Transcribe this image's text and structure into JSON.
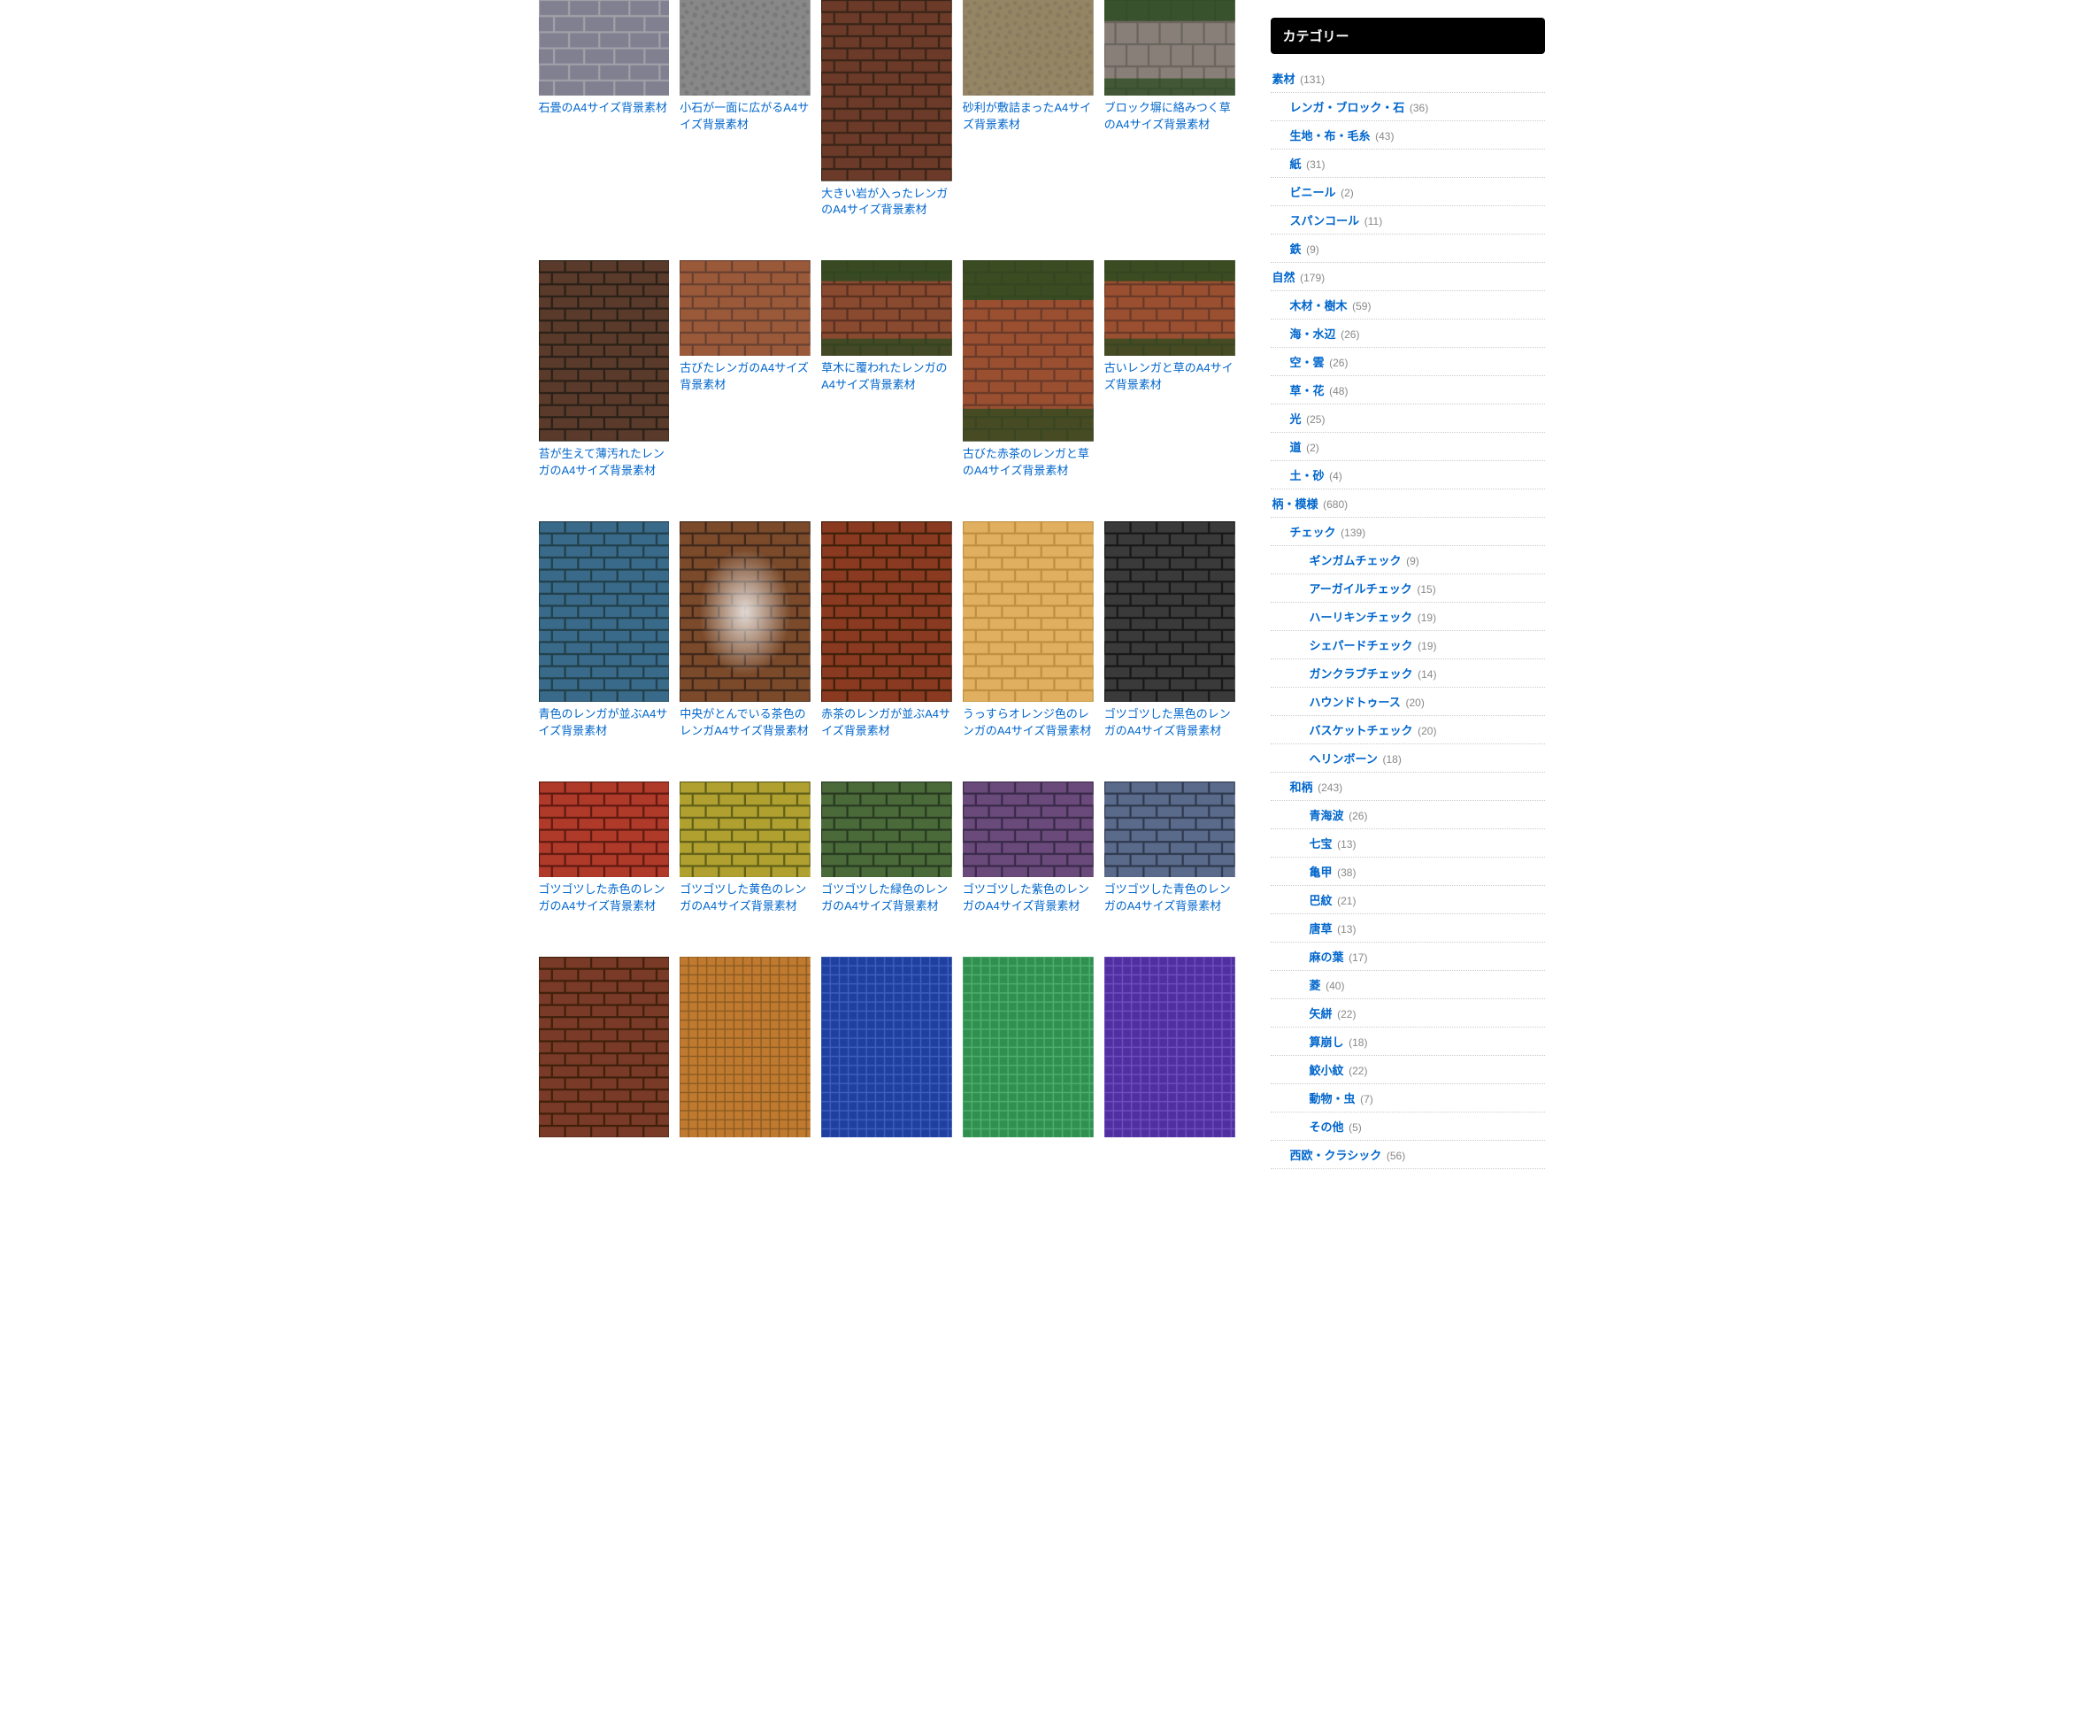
{
  "sidebar": {
    "title": "カテゴリー",
    "categories": [
      {
        "label": "素材",
        "count": "(131)",
        "level": 0
      },
      {
        "label": "レンガ・ブロック・石",
        "count": "(36)",
        "level": 1
      },
      {
        "label": "生地・布・毛糸",
        "count": "(43)",
        "level": 1
      },
      {
        "label": "紙",
        "count": "(31)",
        "level": 1
      },
      {
        "label": "ビニール",
        "count": "(2)",
        "level": 1
      },
      {
        "label": "スパンコール",
        "count": "(11)",
        "level": 1
      },
      {
        "label": "鉄",
        "count": "(9)",
        "level": 1
      },
      {
        "label": "自然",
        "count": "(179)",
        "level": 0
      },
      {
        "label": "木材・樹木",
        "count": "(59)",
        "level": 1
      },
      {
        "label": "海・水辺",
        "count": "(26)",
        "level": 1
      },
      {
        "label": "空・雲",
        "count": "(26)",
        "level": 1
      },
      {
        "label": "草・花",
        "count": "(48)",
        "level": 1
      },
      {
        "label": "光",
        "count": "(25)",
        "level": 1
      },
      {
        "label": "道",
        "count": "(2)",
        "level": 1
      },
      {
        "label": "土・砂",
        "count": "(4)",
        "level": 1
      },
      {
        "label": "柄・模様",
        "count": "(680)",
        "level": 0
      },
      {
        "label": "チェック",
        "count": "(139)",
        "level": 1
      },
      {
        "label": "ギンガムチェック",
        "count": "(9)",
        "level": 2
      },
      {
        "label": "アーガイルチェック",
        "count": "(15)",
        "level": 2
      },
      {
        "label": "ハーリキンチェック",
        "count": "(19)",
        "level": 2
      },
      {
        "label": "シェパードチェック",
        "count": "(19)",
        "level": 2
      },
      {
        "label": "ガンクラブチェック",
        "count": "(14)",
        "level": 2
      },
      {
        "label": "ハウンドトゥース",
        "count": "(20)",
        "level": 2
      },
      {
        "label": "バスケットチェック",
        "count": "(20)",
        "level": 2
      },
      {
        "label": "ヘリンボーン",
        "count": "(18)",
        "level": 2
      },
      {
        "label": "和柄",
        "count": "(243)",
        "level": 1
      },
      {
        "label": "青海波",
        "count": "(26)",
        "level": 2
      },
      {
        "label": "七宝",
        "count": "(13)",
        "level": 2
      },
      {
        "label": "亀甲",
        "count": "(38)",
        "level": 2
      },
      {
        "label": "巴紋",
        "count": "(21)",
        "level": 2
      },
      {
        "label": "唐草",
        "count": "(13)",
        "level": 2
      },
      {
        "label": "麻の葉",
        "count": "(17)",
        "level": 2
      },
      {
        "label": "菱",
        "count": "(40)",
        "level": 2
      },
      {
        "label": "矢絣",
        "count": "(22)",
        "level": 2
      },
      {
        "label": "算崩し",
        "count": "(18)",
        "level": 2
      },
      {
        "label": "鮫小紋",
        "count": "(22)",
        "level": 2
      },
      {
        "label": "動物・虫",
        "count": "(7)",
        "level": 2
      },
      {
        "label": "その他",
        "count": "(5)",
        "level": 2
      },
      {
        "label": "西欧・クラシック",
        "count": "(56)",
        "level": 1
      }
    ]
  },
  "items": [
    {
      "title": "石畳のA4サイズ背景素材",
      "shape": "landscape",
      "fill": "#808090",
      "mortar": "#a0a0a8",
      "preset": "stone"
    },
    {
      "title": "小石が一面に広がるA4サイズ背景素材",
      "shape": "landscape",
      "fill": "#7a7a7a",
      "mortar": "#888",
      "preset": "gravel"
    },
    {
      "title": "大きい岩が入ったレンガのA4サイズ背景素材",
      "shape": "portrait",
      "fill": "#6b3a28",
      "mortar": "#3a2418",
      "preset": "brick"
    },
    {
      "title": "砂利が敷詰まったA4サイズ背景素材",
      "shape": "landscape",
      "fill": "#8a7a60",
      "mortar": "#948564",
      "preset": "gravel"
    },
    {
      "title": "ブロック塀に絡みつく草のA4サイズ背景素材",
      "shape": "landscape",
      "fill": "#888078",
      "mortar": "#6a655e",
      "preset": "block-grass"
    },
    {
      "title": "苔が生えて薄汚れたレンガのA4サイズ背景素材",
      "shape": "portrait",
      "fill": "#5a3a2a",
      "mortar": "#2a2018",
      "preset": "brick"
    },
    {
      "title": "古びたレンガのA4サイズ背景素材",
      "shape": "landscape",
      "fill": "#9a5a3a",
      "mortar": "#6a4030",
      "preset": "brick"
    },
    {
      "title": "草木に覆われたレンガのA4サイズ背景素材",
      "shape": "landscape",
      "fill": "#8a4a30",
      "mortar": "#5a3020",
      "preset": "brick-grass"
    },
    {
      "title": "古びた赤茶のレンガと草のA4サイズ背景素材",
      "shape": "portrait",
      "fill": "#9a5030",
      "mortar": "#6a3a28",
      "preset": "brick-grass"
    },
    {
      "title": "古いレンガと草のA4サイズ背景素材",
      "shape": "landscape",
      "fill": "#9a5030",
      "mortar": "#6a3a28",
      "preset": "brick-grass"
    },
    {
      "title": "青色のレンガが並ぶA4サイズ背景素材",
      "shape": "portrait",
      "fill": "#3a6a8a",
      "mortar": "#20404a",
      "preset": "brick"
    },
    {
      "title": "中央がとんでいる茶色のレンガA4サイズ背景素材",
      "shape": "portrait",
      "fill": "#7a4a2a",
      "mortar": "#40281a",
      "preset": "brick-glow"
    },
    {
      "title": "赤茶のレンガが並ぶA4サイズ背景素材",
      "shape": "portrait",
      "fill": "#8a3a20",
      "mortar": "#40200a",
      "preset": "brick"
    },
    {
      "title": "うっすらオレンジ色のレンガのA4サイズ背景素材",
      "shape": "portrait",
      "fill": "#e0b060",
      "mortar": "#c09040",
      "preset": "brick"
    },
    {
      "title": "ゴツゴツした黒色のレンガのA4サイズ背景素材",
      "shape": "portrait",
      "fill": "#3a3a3a",
      "mortar": "#181818",
      "preset": "brick"
    },
    {
      "title": "ゴツゴツした赤色のレンガのA4サイズ背景素材",
      "shape": "landscape",
      "fill": "#b03a2a",
      "mortar": "#601a10",
      "preset": "brick"
    },
    {
      "title": "ゴツゴツした黄色のレンガのA4サイズ背景素材",
      "shape": "landscape",
      "fill": "#b0a030",
      "mortar": "#606018",
      "preset": "brick"
    },
    {
      "title": "ゴツゴツした緑色のレンガのA4サイズ背景素材",
      "shape": "landscape",
      "fill": "#4a6a3a",
      "mortar": "#283a20",
      "preset": "brick"
    },
    {
      "title": "ゴツゴツした紫色のレンガのA4サイズ背景素材",
      "shape": "landscape",
      "fill": "#6a4a7a",
      "mortar": "#3a2a4a",
      "preset": "brick"
    },
    {
      "title": "ゴツゴツした青色のレンガのA4サイズ背景素材",
      "shape": "landscape",
      "fill": "#5a6a8a",
      "mortar": "#303a50",
      "preset": "brick"
    },
    {
      "title": "",
      "shape": "portrait",
      "fill": "#7a3a28",
      "mortar": "#40200a",
      "preset": "brick"
    },
    {
      "title": "",
      "shape": "portrait",
      "fill": "#c07a30",
      "mortar": "#8a5a20",
      "preset": "tile"
    },
    {
      "title": "",
      "shape": "portrait",
      "fill": "#2040a0",
      "mortar": "#4060c0",
      "preset": "tile"
    },
    {
      "title": "",
      "shape": "portrait",
      "fill": "#309050",
      "mortar": "#50b070",
      "preset": "tile"
    },
    {
      "title": "",
      "shape": "portrait",
      "fill": "#5030a0",
      "mortar": "#7050c0",
      "preset": "tile"
    }
  ]
}
